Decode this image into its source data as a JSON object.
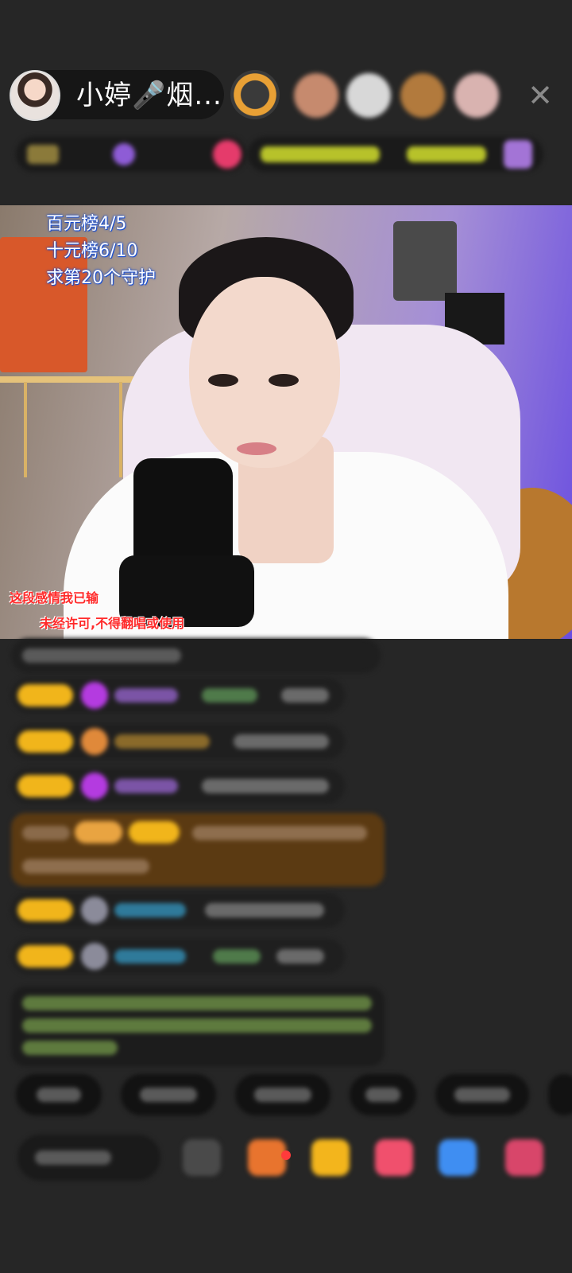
{
  "header": {
    "host_name": "小婷🎤烟...",
    "close_glyph": "✕"
  },
  "stream": {
    "overlay_lines": [
      "百元榜4/5",
      "十元榜6/10",
      "求第20个守护"
    ],
    "song_title": "这段感情我已输",
    "copyright_notice": "未经许可,不得翻唱或使用"
  },
  "colors": {
    "background": "#262626",
    "badge_gold": "#f1b51b",
    "gift_purple": "#b43be0",
    "highlight_brown": "#5b3a12",
    "chat_green": "#9be07a",
    "chat_cyan": "#3fb8e8"
  },
  "icons": {
    "close": "close-icon",
    "gift": "gift-icon",
    "more": "more-icon"
  }
}
